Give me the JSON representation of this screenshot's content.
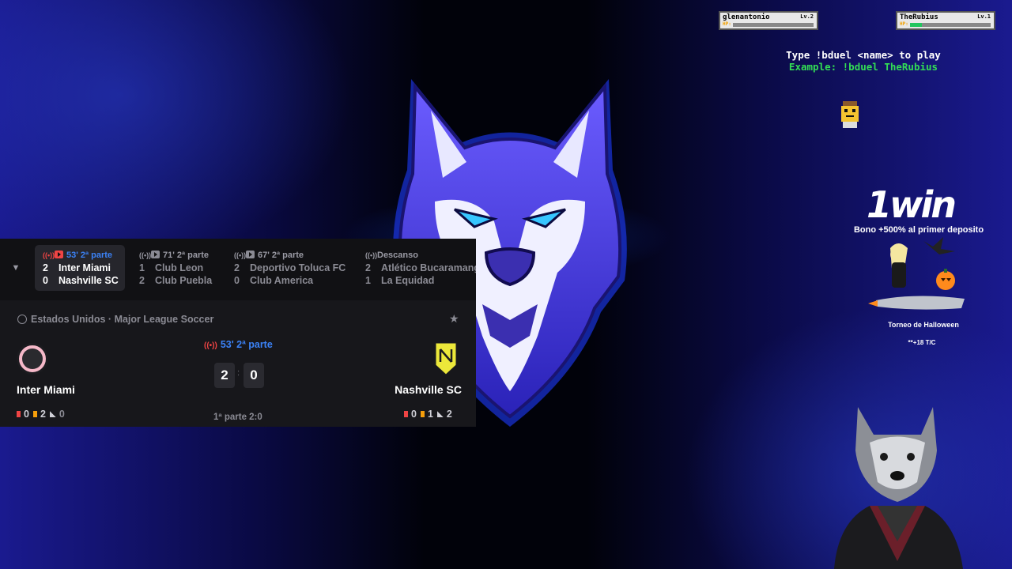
{
  "hud": {
    "player1": {
      "name": "glenantonio",
      "level": "Lv.2",
      "hp_label": "HP:",
      "hp_fraction": 0.0
    },
    "player2": {
      "name": "TheRubius",
      "level": "Lv.1",
      "hp_label": "HP:",
      "hp_fraction": 0.15
    },
    "duel_line1": "Type !bduel <name> to play",
    "duel_line2": "Example: !bduel TheRubius"
  },
  "sponsor": {
    "brand": "1win",
    "bonus": "Bono +500% al primer deposito",
    "tournament": "Torneo de Halloween",
    "tc": "**+18 T/C"
  },
  "ticker": [
    {
      "status": "53' 2ª parte",
      "home_score": "2",
      "home": "Inter Miami",
      "away_score": "0",
      "away": "Nashville SC"
    },
    {
      "status": "71' 2ª parte",
      "home_score": "1",
      "home": "Club Leon",
      "away_score": "2",
      "away": "Club Puebla"
    },
    {
      "status": "67' 2ª parte",
      "home_score": "2",
      "home": "Deportivo Toluca FC",
      "away_score": "0",
      "away": "Club America"
    },
    {
      "status": "Descanso",
      "home_score": "2",
      "home": "Atlético Bucaramanga",
      "away_score": "1",
      "away": "La Equidad"
    }
  ],
  "match": {
    "league": "Estados Unidos · Major League Soccer",
    "status": "53' 2ª parte",
    "home": "Inter Miami",
    "away": "Nashville SC",
    "home_score": "2",
    "away_score": "0",
    "separator": ":",
    "halftime": "1ª parte 2:0",
    "home_stats": {
      "red": "0",
      "yellow": "2",
      "corners": "0"
    },
    "away_stats": {
      "red": "0",
      "yellow": "1",
      "corners": "2"
    }
  }
}
